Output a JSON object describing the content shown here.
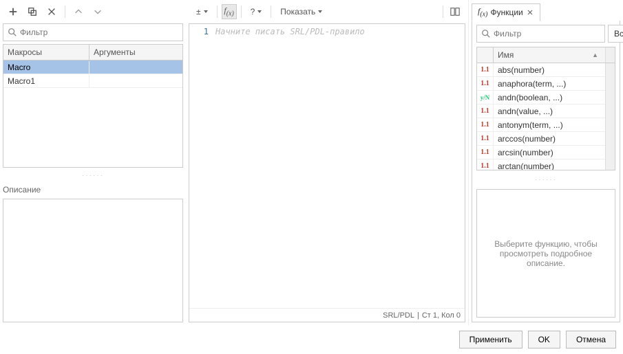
{
  "left": {
    "filter_placeholder": "Фильтр",
    "table": {
      "col_macros": "Макросы",
      "col_args": "Аргументы",
      "rows": [
        {
          "name": "Macro",
          "args": "",
          "selected": true,
          "editing": true
        },
        {
          "name": "Macro1",
          "args": "",
          "selected": false,
          "editing": false
        }
      ]
    },
    "desc_label": "Описание"
  },
  "center": {
    "show_label": "Показать",
    "editor_placeholder": "Начните писать SRL/PDL-правило",
    "line_number": "1",
    "status_lang": "SRL/PDL",
    "status_pos": "Ст 1, Кол 0"
  },
  "right": {
    "tab_label": "Функции",
    "filter_placeholder": "Фильтр",
    "scope_label": "Все функции",
    "col_name": "Имя",
    "functions": [
      {
        "icon": "11",
        "sig": "abs(number)"
      },
      {
        "icon": "11",
        "sig": "anaphora(term, ...)"
      },
      {
        "icon": "yn",
        "sig": "andn(boolean, ...)"
      },
      {
        "icon": "11",
        "sig": "andn(value, ...)"
      },
      {
        "icon": "11",
        "sig": "antonym(term, ...)"
      },
      {
        "icon": "11",
        "sig": "arccos(number)"
      },
      {
        "icon": "11",
        "sig": "arcsin(number)"
      },
      {
        "icon": "11",
        "sig": "arctan(number)"
      }
    ],
    "desc_placeholder": "Выберите функцию, чтобы просмотреть подробное описание."
  },
  "buttons": {
    "apply": "Применить",
    "ok": "OK",
    "cancel": "Отмена"
  }
}
